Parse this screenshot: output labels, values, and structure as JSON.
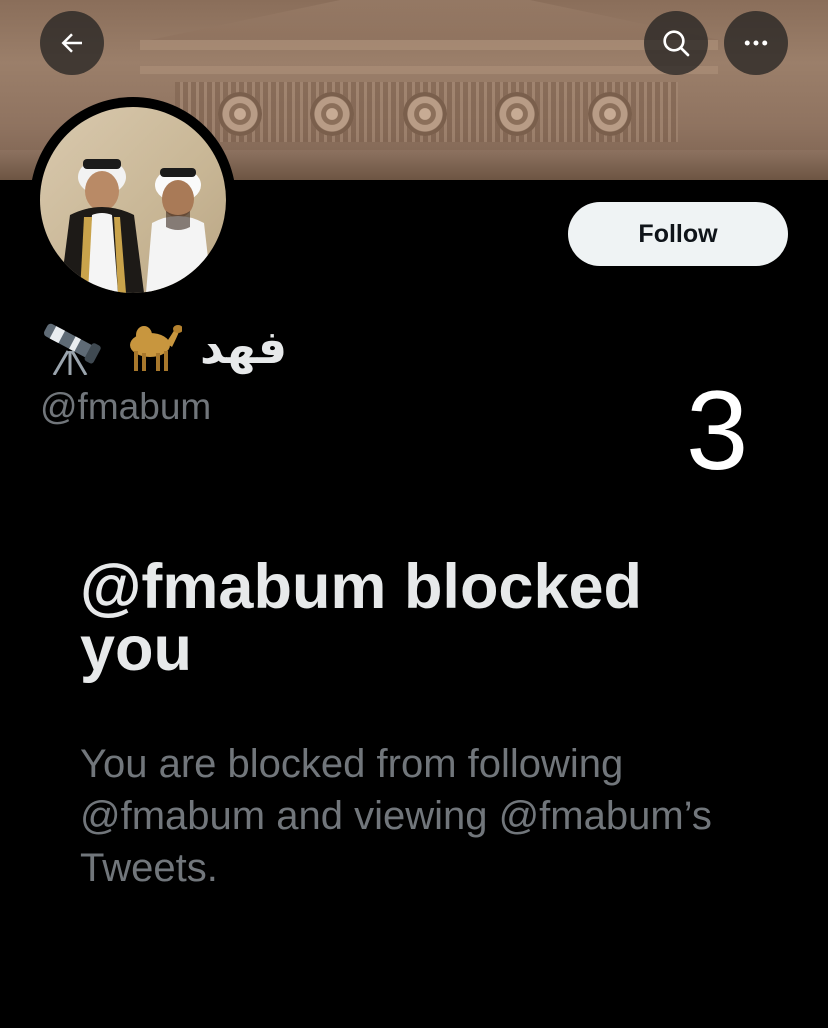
{
  "profile": {
    "display_name": "فهد",
    "handle": "@fmabum",
    "name_emojis": [
      "camel-emoji",
      "telescope-emoji"
    ]
  },
  "header": {
    "back_icon": "arrow-left-icon",
    "search_icon": "search-icon",
    "more_icon": "more-horizontal-icon"
  },
  "actions": {
    "follow_label": "Follow"
  },
  "overlay": {
    "step_number": "3"
  },
  "blocked": {
    "title": "@fmabum blocked you",
    "message": "You are blocked from following @fmabum and viewing @fmabum’s Tweets."
  },
  "colors": {
    "background": "#000000",
    "primary_text": "#e7e9ea",
    "secondary_text": "#71767b",
    "follow_button_bg": "#eff3f4",
    "follow_button_text": "#0f1419"
  }
}
